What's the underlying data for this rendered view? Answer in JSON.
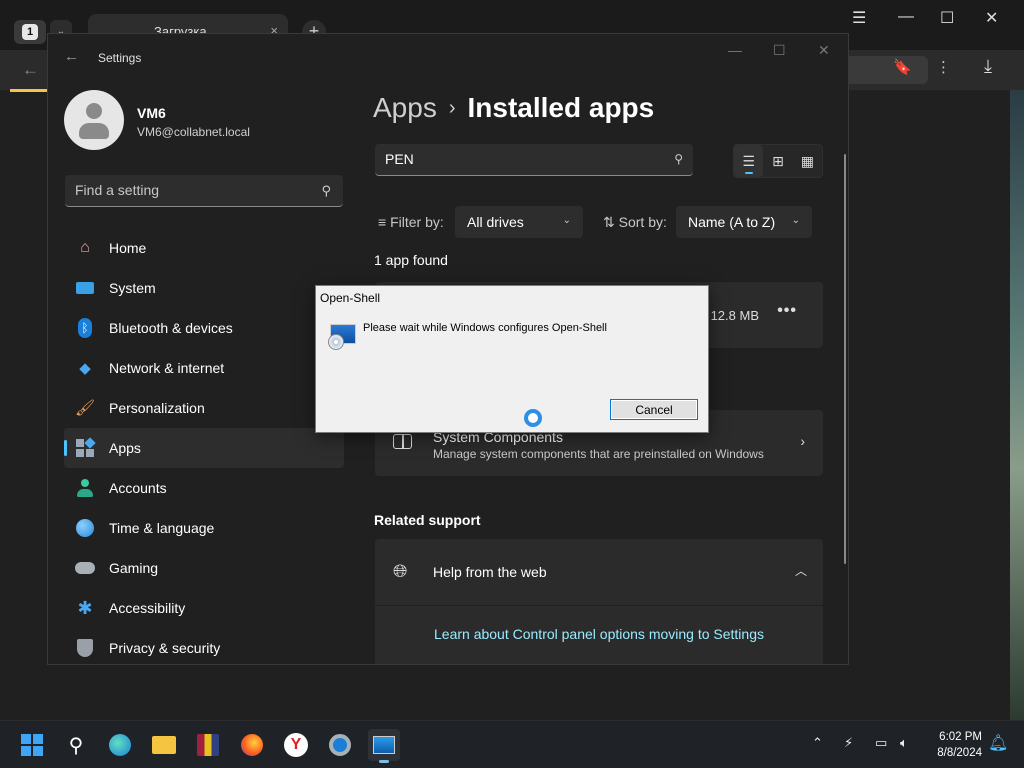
{
  "browser": {
    "tab_count": "1",
    "tab_title": "Загрузка",
    "tab_close": "×",
    "new_tab": "+"
  },
  "settings": {
    "window_title": "Settings",
    "user": {
      "name": "VM6",
      "email": "VM6@collabnet.local"
    },
    "find_placeholder": "Find a setting",
    "nav": [
      {
        "label": "Home",
        "icon": "home-icon"
      },
      {
        "label": "System",
        "icon": "system-icon"
      },
      {
        "label": "Bluetooth & devices",
        "icon": "bluetooth-icon"
      },
      {
        "label": "Network & internet",
        "icon": "wifi-icon"
      },
      {
        "label": "Personalization",
        "icon": "brush-icon"
      },
      {
        "label": "Apps",
        "icon": "apps-icon",
        "active": true
      },
      {
        "label": "Accounts",
        "icon": "accounts-icon"
      },
      {
        "label": "Time & language",
        "icon": "globe-clock-icon"
      },
      {
        "label": "Gaming",
        "icon": "gamepad-icon"
      },
      {
        "label": "Accessibility",
        "icon": "accessibility-icon"
      },
      {
        "label": "Privacy & security",
        "icon": "shield-icon"
      }
    ],
    "breadcrumb": {
      "parent": "Apps",
      "separator": "›",
      "current": "Installed apps"
    },
    "search_value": "PEN",
    "filter": {
      "label": "Filter by:",
      "value": "All drives"
    },
    "sort": {
      "label": "Sort by:",
      "value": "Name (A to Z)"
    },
    "result_count": "1 app found",
    "app": {
      "size": "12.8 MB",
      "more": "•••"
    },
    "system_components": {
      "title": "System Components",
      "description": "Manage system components that are preinstalled on Windows"
    },
    "related_support": "Related support",
    "help": {
      "title": "Help from the web",
      "link": "Learn about Control panel options moving to Settings"
    }
  },
  "dialog": {
    "title": "Open-Shell",
    "message": "Please wait while Windows configures Open-Shell",
    "cancel_label": "Cancel"
  },
  "taskbar": {
    "time": "6:02 PM",
    "date": "8/8/2024",
    "accent": "#3fa6f5"
  }
}
